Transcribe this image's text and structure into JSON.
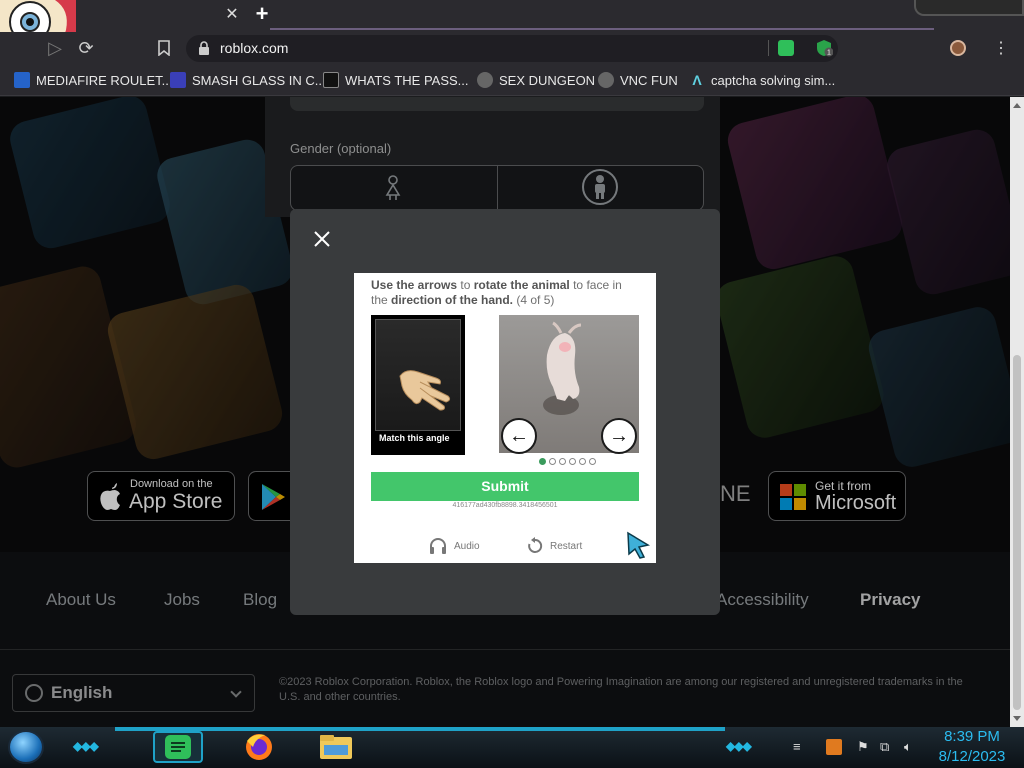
{
  "browser": {
    "tab_close": "✕",
    "new_tab": "+",
    "url": "roblox.com",
    "extension_badge": "1",
    "bookmarks": [
      {
        "label": "MEDIAFIRE ROULET...",
        "icon": "mediafire-icon"
      },
      {
        "label": "SMASH GLASS IN C...",
        "icon": "bookmark-icon"
      },
      {
        "label": "WHATS THE PASS...",
        "icon": "bookmark-icon"
      },
      {
        "label": "SEX DUNGEON",
        "icon": "bookmark-icon"
      },
      {
        "label": "VNC FUN",
        "icon": "bookmark-icon"
      },
      {
        "label": "captcha solving sim...",
        "icon": "bookmark-icon"
      }
    ]
  },
  "page": {
    "gender_label": "Gender (optional)",
    "app_store": {
      "small": "Download on the",
      "big": "App Store"
    },
    "microsoft": {
      "small": "Get it from",
      "big": "Microsoft"
    },
    "partial_store_text": "NE",
    "footer_links": [
      "About Us",
      "Jobs",
      "Blog",
      "Accessibility",
      "Privacy"
    ],
    "language": "English",
    "copyright": "©2023 Roblox Corporation. Roblox, the Roblox logo and Powering Imagination are among our registered and unregistered trademarks in the U.S. and other countries."
  },
  "captcha": {
    "instr_1": "Use the arrows",
    "instr_2": " to ",
    "instr_3": "rotate the animal",
    "instr_4": " to face in the ",
    "instr_5": "direction of the hand.",
    "instr_6": " (4 of 5)",
    "match_label": "Match this angle",
    "left_arrow": "←",
    "right_arrow": "→",
    "submit": "Submit",
    "session_id": "416177ad430fb8898.3418456501",
    "audio": "Audio",
    "restart": "Restart",
    "progress_total": 6,
    "progress_active": 1
  },
  "taskbar": {
    "time": "8:39 PM",
    "date": "8/12/2023"
  },
  "colors": {
    "accent_green": "#43c66b",
    "taskbar_cyan": "#2bbcf0",
    "modal_bg": "#393b3d"
  }
}
